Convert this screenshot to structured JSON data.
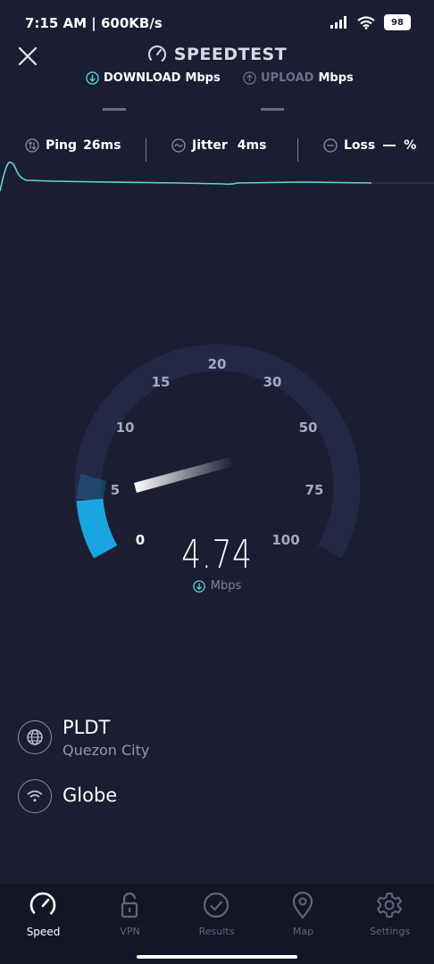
{
  "status_bar": {
    "time": "7:15 AM | 600KB/s",
    "battery": "98"
  },
  "header": {
    "title": "SPEEDTEST"
  },
  "tabs": {
    "download": {
      "label": "DOWNLOAD",
      "unit": "Mbps"
    },
    "upload": {
      "label": "UPLOAD",
      "unit": "Mbps"
    }
  },
  "metrics": {
    "ping": {
      "label": "Ping",
      "value": "26ms"
    },
    "jitter": {
      "label": "Jitter",
      "value": "4ms"
    },
    "loss": {
      "label": "Loss",
      "value": "%"
    }
  },
  "gauge": {
    "ticks": [
      "0",
      "5",
      "10",
      "15",
      "20",
      "30",
      "50",
      "75",
      "100"
    ],
    "current_speed": "4.74",
    "unit": "Mbps"
  },
  "providers": {
    "isp": {
      "name": "PLDT",
      "location": "Quezon City"
    },
    "network": {
      "name": "Globe"
    }
  },
  "nav": {
    "items": [
      {
        "label": "Speed"
      },
      {
        "label": "VPN"
      },
      {
        "label": "Results"
      },
      {
        "label": "Map"
      },
      {
        "label": "Settings"
      }
    ]
  },
  "colors": {
    "background": "#1b1d33",
    "accent": "#19a6e0",
    "graph": "#5fd7d2",
    "track": "#232945"
  }
}
